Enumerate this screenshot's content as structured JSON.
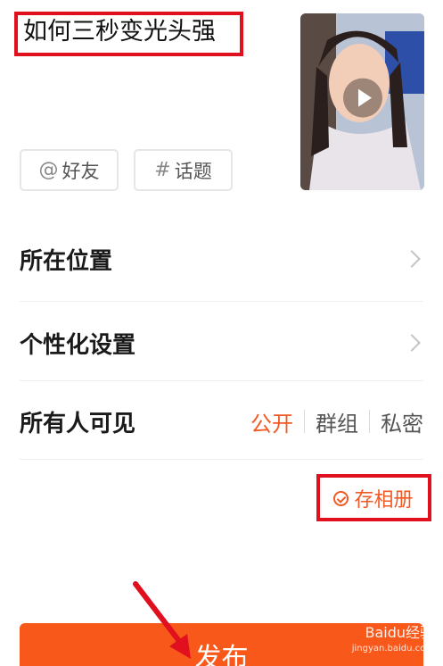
{
  "caption": "如何三秒变光头强",
  "thumbnail": {
    "icon": "play-icon"
  },
  "chips": {
    "friend_symbol": "@",
    "friend_label": "好友",
    "topic_symbol": "#",
    "topic_label": "话题"
  },
  "rows": {
    "location": "所在位置",
    "personalization": "个性化设置",
    "visibility": "所有人可见"
  },
  "visibility_options": [
    "公开",
    "群组",
    "私密"
  ],
  "visibility_selected": "公开",
  "save_album": "存相册",
  "publish_button": "发布",
  "watermark": {
    "brand": "Baidu经验",
    "url": "jingyan.baidu.com"
  },
  "colors": {
    "accent": "#f15a24",
    "annotation_red": "#e0101e",
    "publish_bg": "#f8581a"
  }
}
